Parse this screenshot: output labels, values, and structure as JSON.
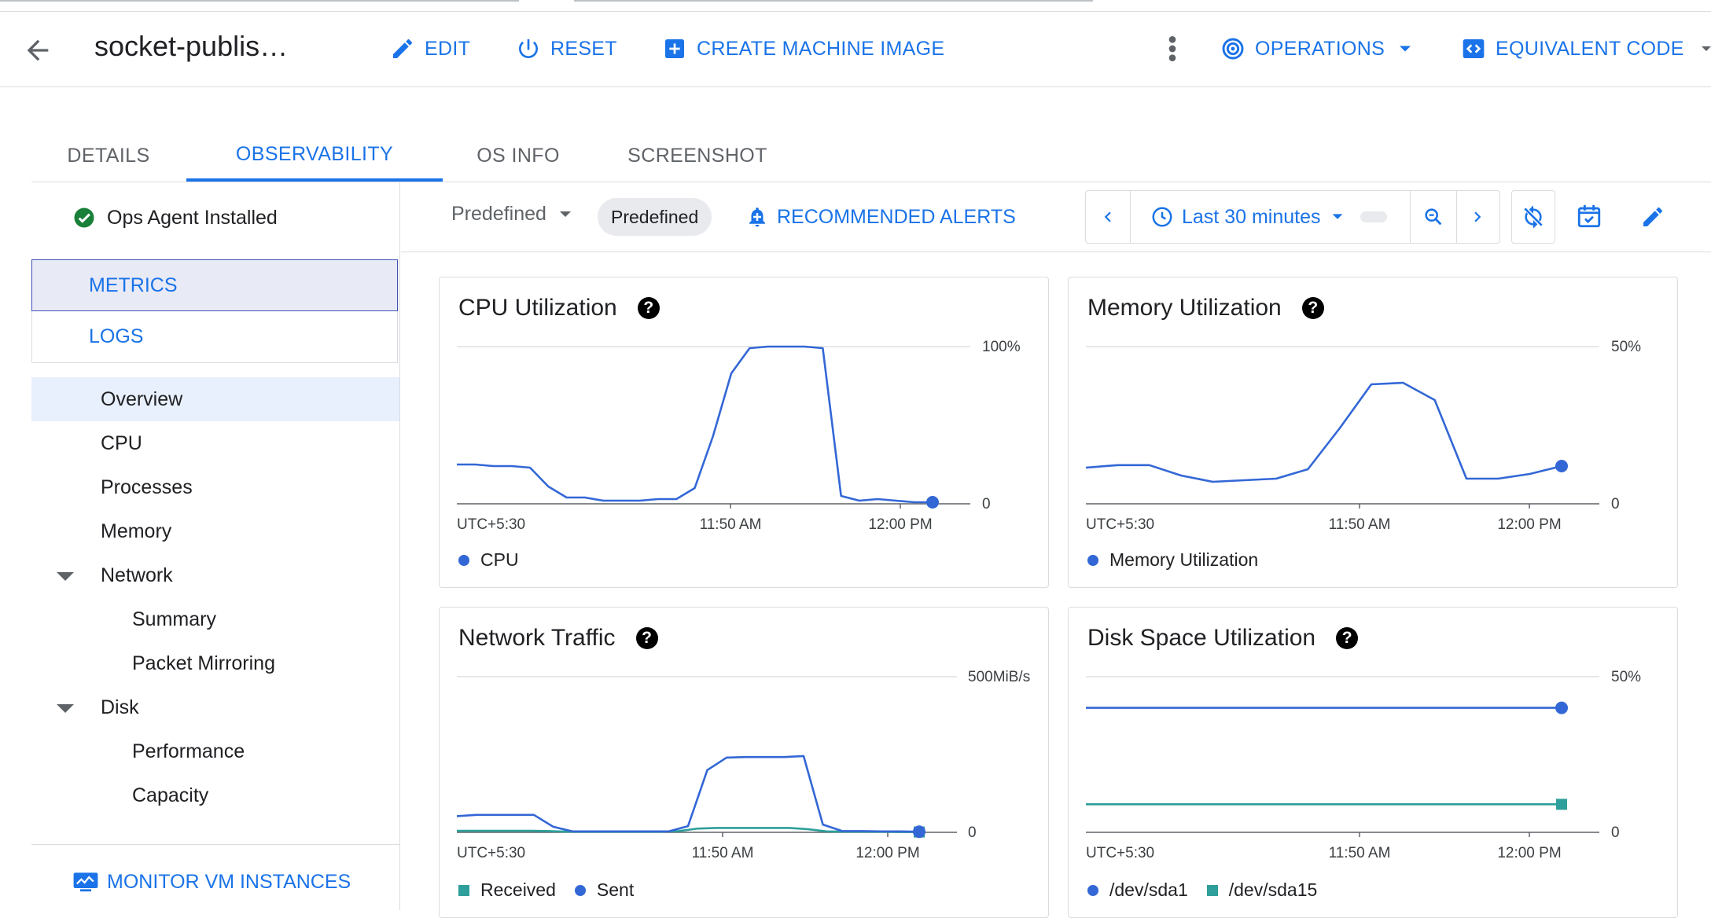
{
  "header": {
    "title": "socket-publis…",
    "edit_label": "EDIT",
    "reset_label": "RESET",
    "create_image_label": "CREATE MACHINE IMAGE",
    "operations_label": "OPERATIONS",
    "equivalent_code_label": "EQUIVALENT CODE"
  },
  "tabs": [
    {
      "label": "DETAILS"
    },
    {
      "label": "OBSERVABILITY"
    },
    {
      "label": "OS INFO"
    },
    {
      "label": "SCREENSHOT"
    }
  ],
  "sidebar": {
    "agent_status": "Ops Agent Installed",
    "metrics_label": "METRICS",
    "logs_label": "LOGS",
    "items": [
      {
        "label": "Overview"
      },
      {
        "label": "CPU"
      },
      {
        "label": "Processes"
      },
      {
        "label": "Memory"
      },
      {
        "label": "Network"
      },
      {
        "label": "Summary"
      },
      {
        "label": "Packet Mirroring"
      },
      {
        "label": "Disk"
      },
      {
        "label": "Performance"
      },
      {
        "label": "Capacity"
      }
    ],
    "monitor_label": "MONITOR VM INSTANCES"
  },
  "toolbar": {
    "dashboard_select": "Predefined",
    "dashboard_chip": "Predefined",
    "alerts_label": "RECOMMENDED ALERTS",
    "time_range": "Last 30 minutes"
  },
  "colors": {
    "accent": "#1a73e8",
    "series_blue": "#3367d6",
    "series_teal": "#2e9f9a",
    "success": "#188038"
  },
  "chart_data": [
    {
      "type": "line",
      "title": "CPU Utilization",
      "x_ticks": [
        "UTC+5:30",
        "11:50 AM",
        "12:00 PM"
      ],
      "y_ticks": [
        "100%",
        "0"
      ],
      "ylim": [
        0,
        100
      ],
      "series": [
        {
          "name": "CPU",
          "color": "#3367d6",
          "values": [
            25,
            25,
            24,
            24,
            23,
            11,
            4,
            4,
            2,
            2,
            2,
            3,
            3,
            10,
            43,
            83,
            99,
            100,
            100,
            100,
            99,
            5,
            2,
            3,
            2,
            1,
            1
          ]
        }
      ]
    },
    {
      "type": "line",
      "title": "Memory Utilization",
      "x_ticks": [
        "UTC+5:30",
        "11:50 AM",
        "12:00 PM"
      ],
      "y_ticks": [
        "50%",
        "0"
      ],
      "ylim": [
        0,
        50
      ],
      "series": [
        {
          "name": "Memory Utilization",
          "color": "#3367d6",
          "values": [
            11.5,
            12.3,
            12.3,
            9,
            7,
            7.5,
            8,
            11,
            24,
            38,
            38.5,
            33,
            8,
            8,
            9.5,
            12
          ]
        }
      ]
    },
    {
      "type": "line",
      "title": "Network Traffic",
      "x_ticks": [
        "UTC+5:30",
        "11:50 AM",
        "12:00 PM"
      ],
      "y_ticks": [
        "500MiB/s",
        "0"
      ],
      "ylim": [
        0,
        500
      ],
      "series": [
        {
          "name": "Received",
          "color": "#2e9f9a",
          "values": [
            5,
            5,
            5,
            5,
            5,
            4,
            2,
            2,
            2,
            2,
            2,
            2,
            4,
            12,
            14,
            14,
            14,
            14,
            14,
            10,
            3,
            2,
            2,
            2,
            1,
            1
          ]
        },
        {
          "name": "Sent",
          "color": "#3367d6",
          "values": [
            52,
            56,
            56,
            56,
            56,
            18,
            3,
            3,
            3,
            3,
            3,
            3,
            20,
            200,
            240,
            242,
            242,
            242,
            245,
            25,
            4,
            4,
            3,
            3,
            2
          ]
        }
      ]
    },
    {
      "type": "line",
      "title": "Disk Space Utilization",
      "x_ticks": [
        "UTC+5:30",
        "11:50 AM",
        "12:00 PM"
      ],
      "y_ticks": [
        "50%",
        "0"
      ],
      "ylim": [
        0,
        50
      ],
      "series": [
        {
          "name": "/dev/sda1",
          "color": "#3367d6",
          "values": [
            40,
            40,
            40,
            40,
            40,
            40
          ]
        },
        {
          "name": "/dev/sda15",
          "color": "#2e9f9a",
          "values": [
            9,
            9,
            9,
            9,
            9,
            9
          ]
        }
      ]
    }
  ]
}
